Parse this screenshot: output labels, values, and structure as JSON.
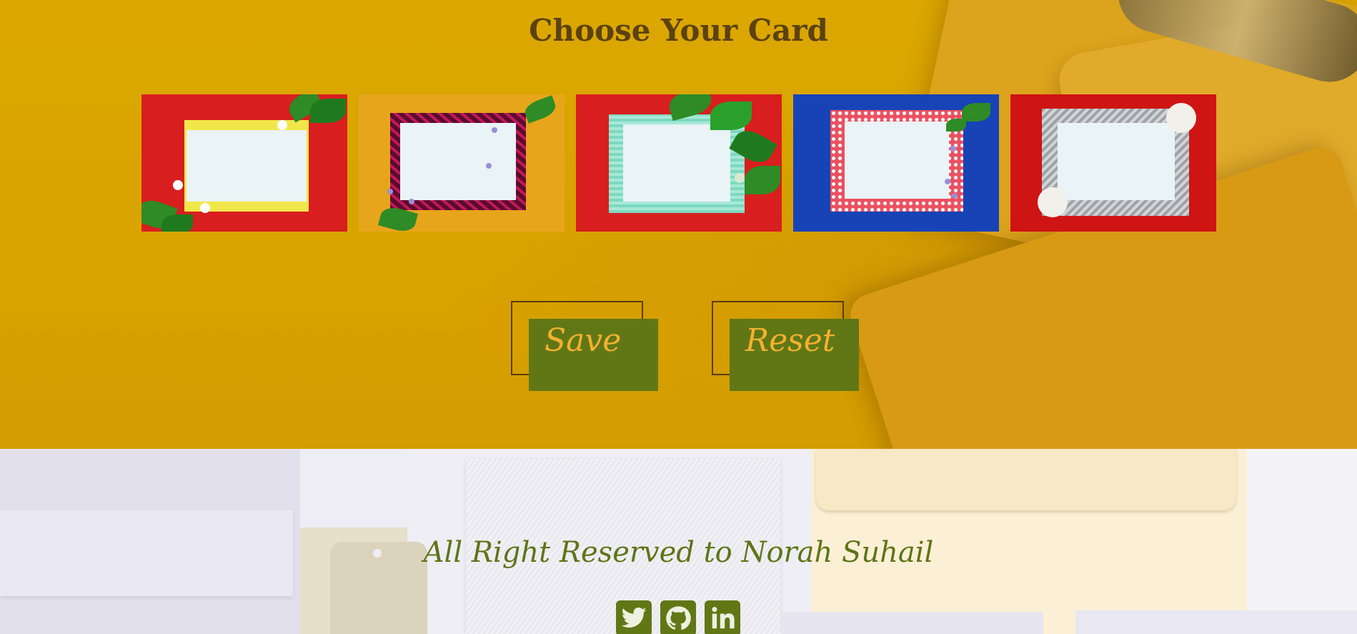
{
  "page": {
    "title": "Choose Your Card"
  },
  "cards": [
    {
      "name": "red-floral-card",
      "background": "#d81e1e",
      "border": "#f2e74a",
      "paper": "#eaf3f6"
    },
    {
      "name": "orange-zebra-card",
      "background": "#e7a51c",
      "border": "#5b0b2e",
      "paper": "#eaf3f6"
    },
    {
      "name": "red-mint-card",
      "background": "#d81e1e",
      "border": "#7ed8c0",
      "paper": "#eaf3f6"
    },
    {
      "name": "blue-floral-card",
      "background": "#1743b7",
      "border": "#ea5060",
      "paper": "#eaf3f6"
    },
    {
      "name": "red-silver-card",
      "background": "#cf1414",
      "border": "#b6b9bd",
      "paper": "#eaf3f6"
    }
  ],
  "actions": {
    "save_label": "Save",
    "reset_label": "Reset"
  },
  "footer": {
    "text": "All Right Reserved to Norah Suhail",
    "social": [
      "twitter-icon",
      "github-icon",
      "linkedin-icon"
    ]
  },
  "colors": {
    "hero_bg": "#dba700",
    "title": "#5b4210",
    "button_bg": "#617716",
    "button_text": "#f3b12e",
    "footer_text": "#5f7417"
  }
}
